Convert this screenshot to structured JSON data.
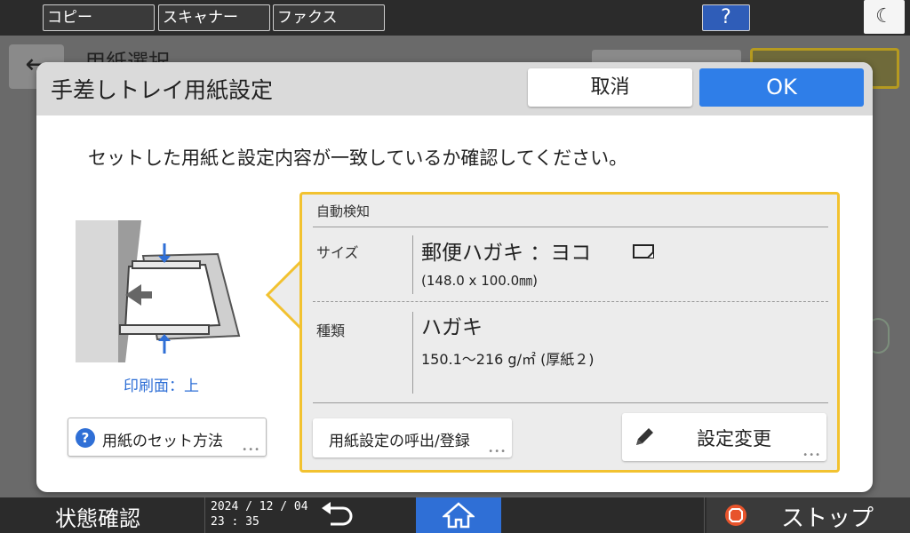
{
  "topbar": {
    "tabs": [
      "コピー",
      "スキャナー",
      "ファクス"
    ],
    "help_label": "?",
    "moon_glyph": "☾"
  },
  "background": {
    "back_glyph": "←",
    "title": "用紙選択"
  },
  "dialog": {
    "title": "手差しトレイ用紙設定",
    "cancel_label": "取消",
    "ok_label": "OK",
    "instruction": "セットした用紙と設定内容が一致しているか確認してください。",
    "print_side": "印刷面：上",
    "howto_label": "用紙のセット方法",
    "panel": {
      "auto_detect": "自動検知",
      "size_label": "サイズ",
      "size_value": "郵便ハガキ ：ヨコ",
      "size_sub": "(148.0 x 100.0㎜)",
      "type_label": "種類",
      "type_value": "ハガキ",
      "type_sub": "150.1～216 g/㎡ (厚紙２)",
      "recall_label": "用紙設定の呼出/登録",
      "change_label": "設定変更"
    }
  },
  "bottombar": {
    "status_label": "状態確認",
    "date": "2024 / 12 / 04",
    "time": "23 : 35",
    "stop_label": "ストップ"
  },
  "colors": {
    "accent_blue": "#2f7ee8",
    "panel_border": "#f2c230",
    "stop_red": "#e8542c"
  }
}
